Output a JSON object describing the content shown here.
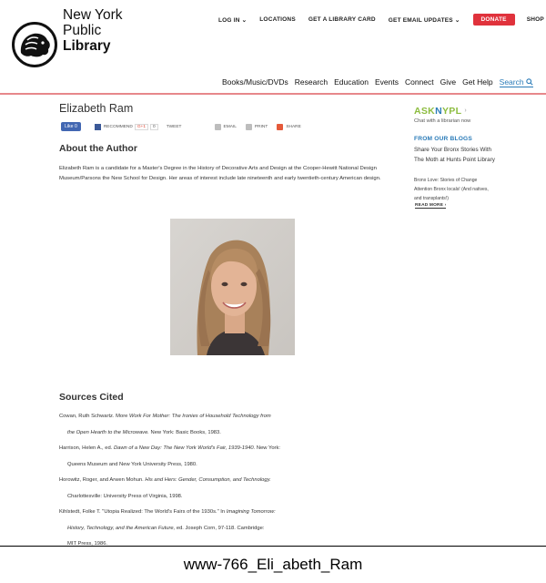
{
  "logo": {
    "line1": "New York",
    "line2": "Public",
    "line3": "Library"
  },
  "utility_nav": {
    "login": "LOG IN",
    "locations": "LOCATIONS",
    "library_card": "GET A LIBRARY CARD",
    "email_updates": "GET EMAIL UPDATES",
    "donate": "DONATE",
    "shop": "SHOP"
  },
  "main_nav": [
    "Books/Music/DVDs",
    "Research",
    "Education",
    "Events",
    "Connect",
    "Give",
    "Get Help"
  ],
  "search_label": "Search",
  "page_title": "Elizabeth Ram",
  "share": {
    "like": "Like 0",
    "recommend": "RECOMMEND",
    "gplus": "G+1",
    "gplus_count": "0",
    "tweet": "TWEET",
    "email": "EMAIL",
    "print": "PRINT",
    "share": "SHARE"
  },
  "about": {
    "heading": "About the Author",
    "text": "Elizabeth Ram is a candidate for a Master's Degree in the History of Decorative Arts and Design at the Cooper-Hewitt National Design Museum/Parsons the New School for Design. Her areas of interest include late nineteenth and early twentieth-century American design."
  },
  "sources": {
    "heading": "Sources Cited",
    "citations": [
      {
        "a": "Cowan, Ruth Schwartz. More ",
        "t": "Work For Mother: The Ironies of Household Technology from",
        "t2": "the Open Hearth to the Microwave.",
        "b": " New York: Basic Books, 1983."
      },
      {
        "a": "Harrison, Helen A., ed. ",
        "t": "Dawn of a New Day: The New York World's Fair, 1939-1940.",
        "b": " New York:",
        "c": "Queens Museum and New York University Press, 1980."
      },
      {
        "a": "Horowitz, Roger, and Arwen Mohun. ",
        "t": "His and Hers: Gender, Consumption, and Technology.",
        "c": "Charlottesville: University Press of Virginia, 1998."
      },
      {
        "a": "Kihlstedt, Folke T. \"Utopia Realized: The World's Fairs of the 1930s.\" In ",
        "t": "Imagining Tomorrow:",
        "t2": "History, Technology, and the American Future,",
        "b": " ed. Joseph Corn, 97-118. Cambridge:",
        "c": "MIT Press, 1986."
      }
    ]
  },
  "sidebar": {
    "ask_a": "ASK",
    "ask_n": "N",
    "ask_b": "YPL",
    "chat": "Chat with a librarian now",
    "blogs_heading": "FROM OUR BLOGS",
    "blog_title": "Share Your Bronx Stories With The Moth at Hunts Point Library",
    "blog_desc": "Bronx Love: Stories of Change Attention Bronx locals! (And natives, and transplants!)",
    "read_more": "READ MORE ›"
  },
  "caption": "www-766_Eli_abeth_Ram",
  "colors": {
    "accent_red": "#e0323c",
    "link_blue": "#2a7bb8",
    "ask_green": "#8cbc3f",
    "nav_rule": "#e7888b"
  }
}
